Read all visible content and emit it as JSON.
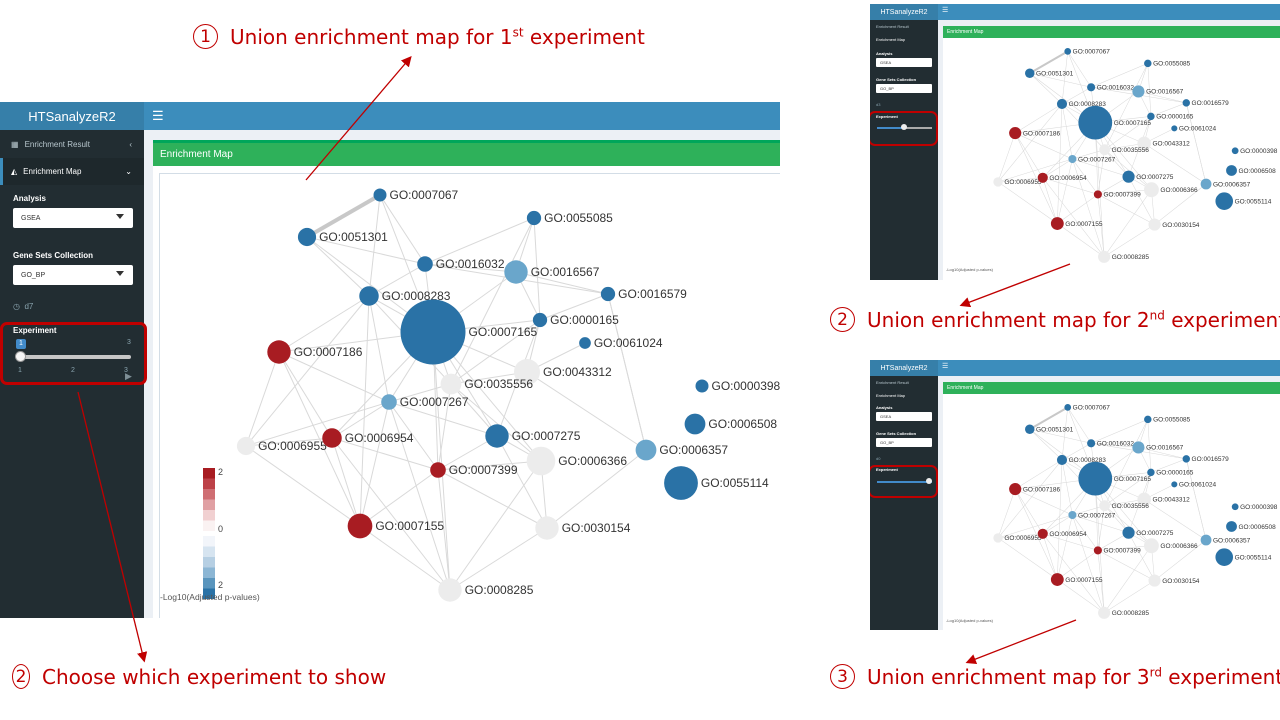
{
  "callouts": {
    "c1": {
      "num": "1",
      "text": "Union enrichment map for 1",
      "sup": "st",
      "tail": " experiment"
    },
    "c2": {
      "num": "2",
      "text": "Choose which experiment to show"
    },
    "c3": {
      "num": "2",
      "text": "Union enrichment map for 2",
      "sup": "nd",
      "tail": " experiment"
    },
    "c4": {
      "num": "3",
      "text": "Union enrichment map for 3",
      "sup": "rd",
      "tail": " experiment"
    }
  },
  "app": {
    "title": "HTSanalyzeR2",
    "menu_icon": "hamburger-icon",
    "sidebar": {
      "items": [
        {
          "label": "Enrichment Result",
          "icon": "table-icon",
          "chevron": "chevron-left-icon"
        },
        {
          "label": "Enrichment Map",
          "icon": "area-chart-icon",
          "chevron": "chevron-down-icon"
        }
      ],
      "analysis_label": "Analysis",
      "analysis_value": "GSEA",
      "collection_label": "Gene Sets Collection",
      "collection_value": "GO_BP",
      "time_label": "d7",
      "experiment_label": "Experiment",
      "slider": {
        "min": "1",
        "max": "3",
        "value": "1",
        "ticks": [
          "1",
          "2",
          "3"
        ]
      }
    },
    "panel_title": "Enrichment Map",
    "legend": {
      "top": "2",
      "mid": "0",
      "bottom": "2",
      "caption": "-Log10(Adjusted p-values)"
    }
  },
  "thumbs": {
    "exp2": {
      "title": "HTSanalyzeR2",
      "menu1": "Enrichment Result",
      "menu2": "Enrichment Map",
      "analysis_label": "Analysis",
      "analysis_value": "GSEA",
      "collection_label": "Gene Sets Collection",
      "collection_value": "GO_BP",
      "time_label": "d3",
      "experiment_label": "Experiment",
      "panel_title": "Enrichment Map",
      "legend_caption": "-Log10(Adjusted p-values)"
    },
    "exp3": {
      "title": "HTSanalyzeR2",
      "menu1": "Enrichment Result",
      "menu2": "Enrichment Map",
      "analysis_label": "Analysis",
      "analysis_value": "GSEA",
      "collection_label": "Gene Sets Collection",
      "collection_value": "GO_BP",
      "time_label": "d0",
      "experiment_label": "Experiment",
      "panel_title": "Enrichment Map",
      "legend_caption": "-Log10(Adjusted p-values)"
    }
  },
  "palette": {
    "strong_red": "#a81c22",
    "light_blue": "#6aa6cb",
    "dark_blue": "#2a72a6",
    "grey": "#ececec"
  },
  "network": {
    "nodes": [
      {
        "id": "GO:0007067",
        "color": "#2a72a6",
        "size": 1
      },
      {
        "id": "GO:0051301",
        "color": "#2a72a6",
        "size": 1.4
      },
      {
        "id": "GO:0055085",
        "color": "#2a72a6",
        "size": 1.1
      },
      {
        "id": "GO:0016032",
        "color": "#2a72a6",
        "size": 1.2
      },
      {
        "id": "GO:0016567",
        "color": "#6aa6cb",
        "size": 1.8
      },
      {
        "id": "GO:0008283",
        "color": "#2a72a6",
        "size": 1.5
      },
      {
        "id": "GO:0016579",
        "color": "#2a72a6",
        "size": 1.1
      },
      {
        "id": "GO:0007165",
        "color": "#2a72a6",
        "size": 5.0
      },
      {
        "id": "GO:0000165",
        "color": "#2a72a6",
        "size": 1.1
      },
      {
        "id": "GO:0061024",
        "color": "#2a72a6",
        "size": 0.9
      },
      {
        "id": "GO:0007186",
        "color": "#a81c22",
        "size": 1.8
      },
      {
        "id": "GO:0043312",
        "color": "#ececec",
        "size": 2.0
      },
      {
        "id": "GO:0035556",
        "color": "#ececec",
        "size": 1.6
      },
      {
        "id": "GO:0000398",
        "color": "#2a72a6",
        "size": 1.0
      },
      {
        "id": "GO:0007267",
        "color": "#6aa6cb",
        "size": 1.2
      },
      {
        "id": "GO:0006508",
        "color": "#2a72a6",
        "size": 1.6
      },
      {
        "id": "GO:0007275",
        "color": "#2a72a6",
        "size": 1.8
      },
      {
        "id": "GO:0006955",
        "color": "#ececec",
        "size": 1.4
      },
      {
        "id": "GO:0006954",
        "color": "#a81c22",
        "size": 1.5
      },
      {
        "id": "GO:0006357",
        "color": "#6aa6cb",
        "size": 1.6
      },
      {
        "id": "GO:0007399",
        "color": "#a81c22",
        "size": 1.2
      },
      {
        "id": "GO:0006366",
        "color": "#ececec",
        "size": 2.2
      },
      {
        "id": "GO:0055114",
        "color": "#2a72a6",
        "size": 2.6
      },
      {
        "id": "GO:0007155",
        "color": "#a81c22",
        "size": 1.9
      },
      {
        "id": "GO:0030154",
        "color": "#ececec",
        "size": 1.8
      },
      {
        "id": "GO:0008285",
        "color": "#ececec",
        "size": 1.8
      }
    ],
    "edges": [
      [
        "GO:0007067",
        "GO:0051301"
      ],
      [
        "GO:0007067",
        "GO:0016032"
      ],
      [
        "GO:0007067",
        "GO:0007165"
      ],
      [
        "GO:0007067",
        "GO:0008283"
      ],
      [
        "GO:0051301",
        "GO:0008283"
      ],
      [
        "GO:0051301",
        "GO:0016032"
      ],
      [
        "GO:0051301",
        "GO:0007165"
      ],
      [
        "GO:0055085",
        "GO:0016032"
      ],
      [
        "GO:0055085",
        "GO:0000165"
      ],
      [
        "GO:0055085",
        "GO:0016567"
      ],
      [
        "GO:0055085",
        "GO:0035556"
      ],
      [
        "GO:0016032",
        "GO:0016567"
      ],
      [
        "GO:0016032",
        "GO:0008283"
      ],
      [
        "GO:0016032",
        "GO:0007165"
      ],
      [
        "GO:0016032",
        "GO:0016579"
      ],
      [
        "GO:0016567",
        "GO:0016579"
      ],
      [
        "GO:0016567",
        "GO:0000165"
      ],
      [
        "GO:0016567",
        "GO:0007165"
      ],
      [
        "GO:0008283",
        "GO:0007165"
      ],
      [
        "GO:0008283",
        "GO:0007186"
      ],
      [
        "GO:0008283",
        "GO:0007267"
      ],
      [
        "GO:0008283",
        "GO:0035556"
      ],
      [
        "GO:0008283",
        "GO:0006955"
      ],
      [
        "GO:0008283",
        "GO:0007155"
      ],
      [
        "GO:0016579",
        "GO:0000165"
      ],
      [
        "GO:0016579",
        "GO:0006357"
      ],
      [
        "GO:0007165",
        "GO:0000165"
      ],
      [
        "GO:0007165",
        "GO:0035556"
      ],
      [
        "GO:0007165",
        "GO:0007186"
      ],
      [
        "GO:0007165",
        "GO:0007267"
      ],
      [
        "GO:0007165",
        "GO:0043312"
      ],
      [
        "GO:0007165",
        "GO:0006954"
      ],
      [
        "GO:0007165",
        "GO:0007399"
      ],
      [
        "GO:0007165",
        "GO:0007275"
      ],
      [
        "GO:0007165",
        "GO:0006366"
      ],
      [
        "GO:0007165",
        "GO:0008285"
      ],
      [
        "GO:0000165",
        "GO:0035556"
      ],
      [
        "GO:0000165",
        "GO:0043312"
      ],
      [
        "GO:0000165",
        "GO:0007275"
      ],
      [
        "GO:0061024",
        "GO:0043312"
      ],
      [
        "GO:0007186",
        "GO:0007267"
      ],
      [
        "GO:0007186",
        "GO:0006955"
      ],
      [
        "GO:0007186",
        "GO:0006954"
      ],
      [
        "GO:0007186",
        "GO:0007155"
      ],
      [
        "GO:0035556",
        "GO:0043312"
      ],
      [
        "GO:0035556",
        "GO:0007267"
      ],
      [
        "GO:0035556",
        "GO:0007275"
      ],
      [
        "GO:0035556",
        "GO:0007399"
      ],
      [
        "GO:0035556",
        "GO:0006366"
      ],
      [
        "GO:0007267",
        "GO:0006954"
      ],
      [
        "GO:0007267",
        "GO:0006955"
      ],
      [
        "GO:0007267",
        "GO:0007399"
      ],
      [
        "GO:0007267",
        "GO:0007155"
      ],
      [
        "GO:0007267",
        "GO:0007275"
      ],
      [
        "GO:0007267",
        "GO:0008285"
      ],
      [
        "GO:0006954",
        "GO:0006955"
      ],
      [
        "GO:0006954",
        "GO:0007155"
      ],
      [
        "GO:0006954",
        "GO:0007399"
      ],
      [
        "GO:0006954",
        "GO:0008285"
      ],
      [
        "GO:0006955",
        "GO:0007155"
      ],
      [
        "GO:0007399",
        "GO:0007155"
      ],
      [
        "GO:0007399",
        "GO:0008285"
      ],
      [
        "GO:0007399",
        "GO:0006366"
      ],
      [
        "GO:0007399",
        "GO:0030154"
      ],
      [
        "GO:0007275",
        "GO:0006366"
      ],
      [
        "GO:0007275",
        "GO:0030154"
      ],
      [
        "GO:0007275",
        "GO:0007399"
      ],
      [
        "GO:0006366",
        "GO:0030154"
      ],
      [
        "GO:0006366",
        "GO:0008285"
      ],
      [
        "GO:0030154",
        "GO:0008285"
      ],
      [
        "GO:0030154",
        "GO:0006357"
      ],
      [
        "GO:0007155",
        "GO:0008285"
      ],
      [
        "GO:0006357",
        "GO:0043312"
      ],
      [
        "GO:0006357",
        "GO:0016579"
      ]
    ]
  }
}
